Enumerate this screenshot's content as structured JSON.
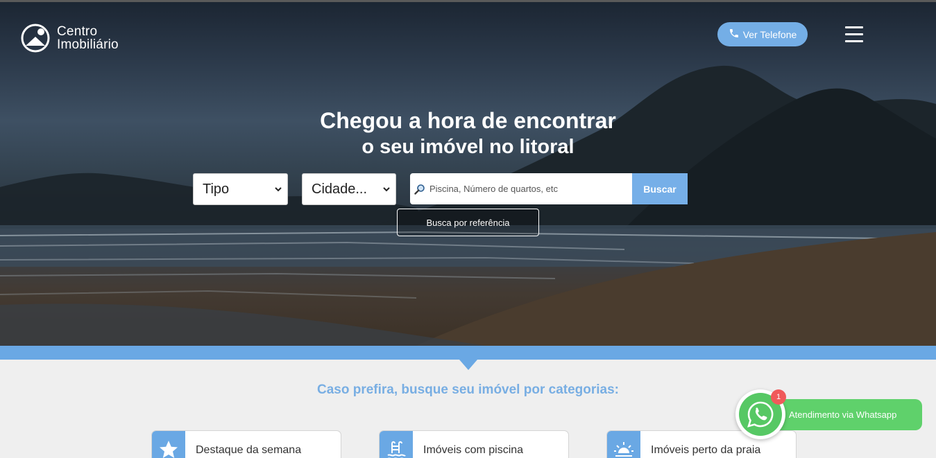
{
  "brand": {
    "line1": "Centro",
    "line2": "Imobiliário"
  },
  "header": {
    "phone_label": "Ver Telefone"
  },
  "hero": {
    "title_line1": "Chegou a hora de encontrar",
    "title_line2": "o seu imóvel no litoral"
  },
  "search": {
    "tipo_value": "Tipo",
    "cidade_value": "Cidade...",
    "placeholder": "Piscina, Número de quartos, etc",
    "button_label": "Buscar",
    "ref_button_label": "Busca por referência"
  },
  "categories": {
    "heading": "Caso prefira, busque seu imóvel por categorias:",
    "items": [
      {
        "label": "Destaque da semana",
        "icon": "star-icon"
      },
      {
        "label": "Imóveis com piscina",
        "icon": "pool-icon"
      },
      {
        "label": "Imóveis perto da praia",
        "icon": "sunset-icon"
      }
    ]
  },
  "whatsapp": {
    "label": "Atendimento via Whatsapp",
    "badge": "1"
  },
  "colors": {
    "accent": "#6aa8e4",
    "whatsapp": "#5fd16b",
    "badge": "#f05a5a"
  }
}
